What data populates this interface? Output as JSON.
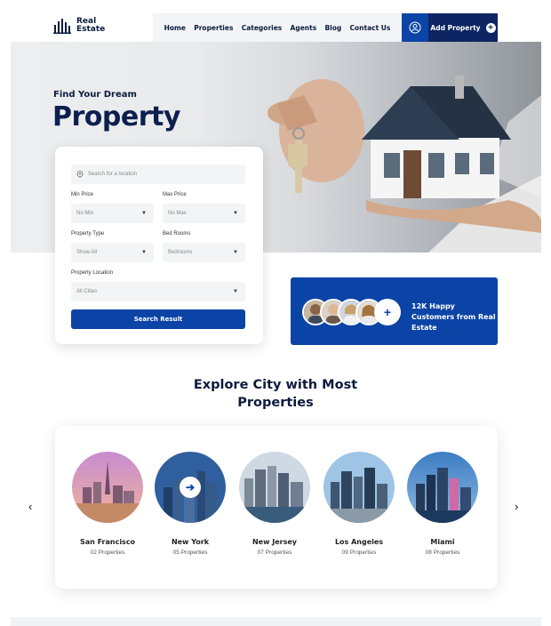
{
  "brand": {
    "line1": "Real",
    "line2": "Estate"
  },
  "nav": [
    "Home",
    "Properties",
    "Categories",
    "Agents",
    "Blog",
    "Contact Us"
  ],
  "header": {
    "add_property": "Add Property",
    "user_icon": "user-icon",
    "plus_icon": "plus-icon"
  },
  "hero": {
    "kicker": "Find Your Dream",
    "title": "Property"
  },
  "search": {
    "location_placeholder": "Search for a location",
    "min_price_label": "Min Price",
    "min_price_value": "No Min",
    "max_price_label": "Max Price",
    "max_price_value": "No Max",
    "property_type_label": "Property Type",
    "property_type_value": "Show All",
    "bedrooms_label": "Bed Rooms",
    "bedrooms_value": "Bedrooms",
    "location_label": "Property Location",
    "location_value": "All Cities",
    "button": "Search Result"
  },
  "customers": {
    "text": "12K Happy Customers from Real Estate"
  },
  "explore": {
    "title_line1": "Explore City with Most",
    "title_line2": "Properties",
    "cities": [
      {
        "name": "San Francisco",
        "count": "02 Properties"
      },
      {
        "name": "New York",
        "count": "05 Properties"
      },
      {
        "name": "New Jersey",
        "count": "07 Properties"
      },
      {
        "name": "Los Angeles",
        "count": "09 Properties"
      },
      {
        "name": "Miami",
        "count": "08 Properties"
      }
    ]
  },
  "colors": {
    "primary": "#0b44a6",
    "navy": "#0d2562",
    "text_dark": "#0b1b3d"
  }
}
